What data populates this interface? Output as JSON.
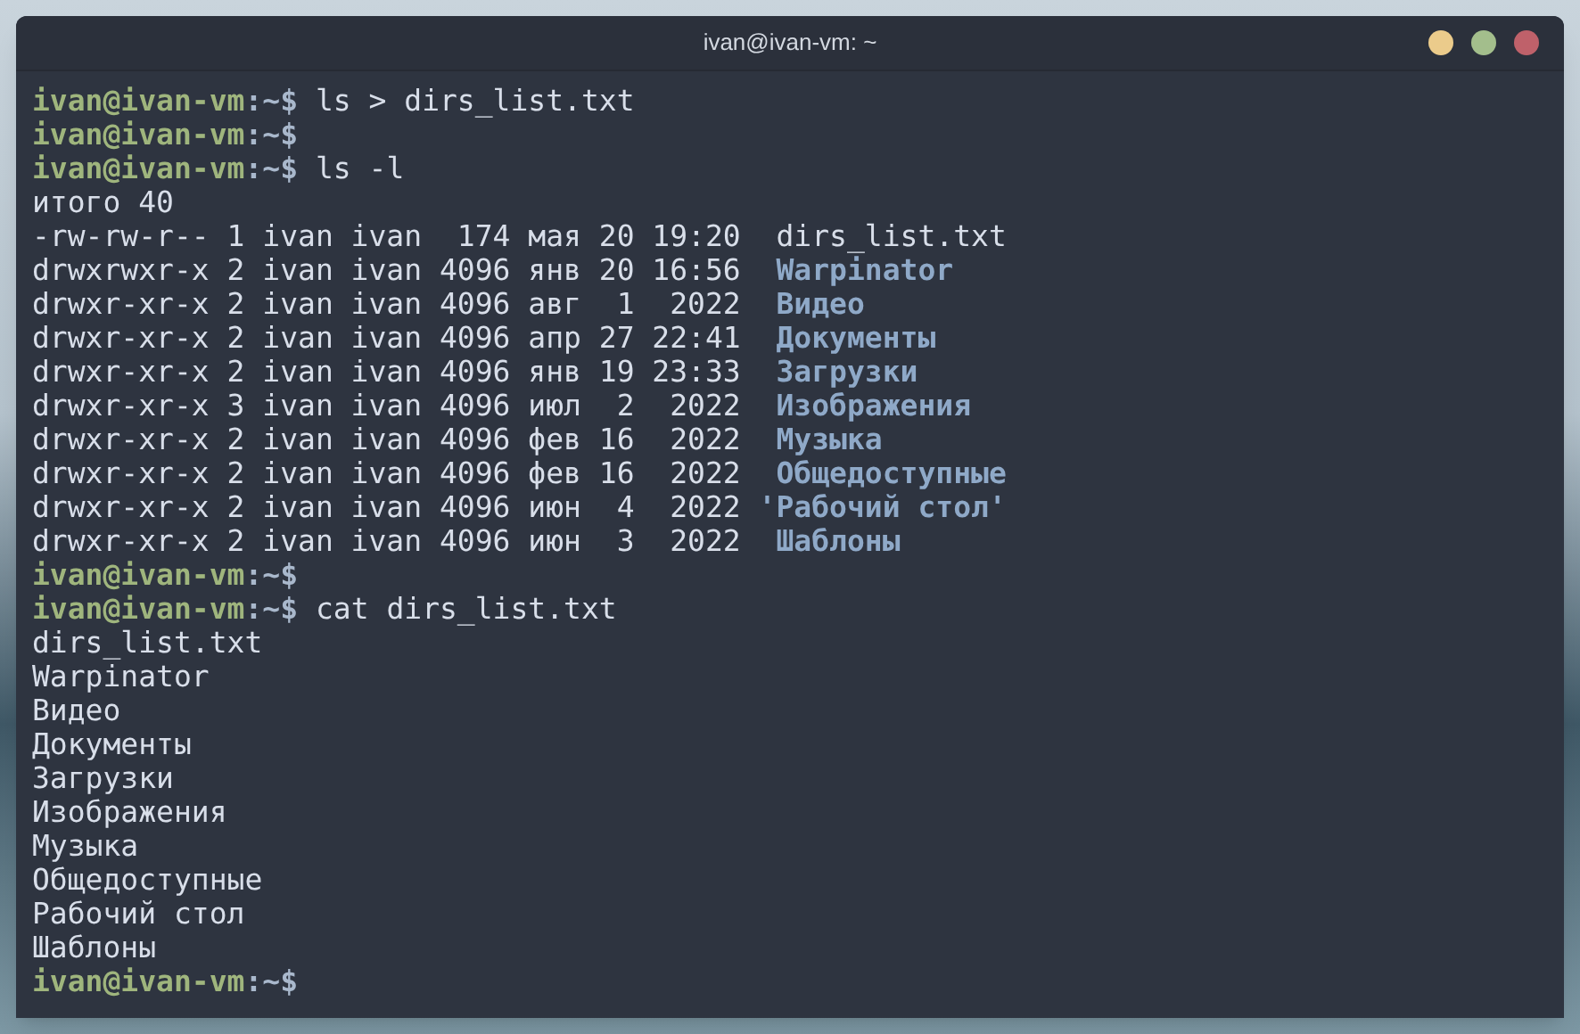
{
  "window": {
    "title": "ivan@ivan-vm: ~"
  },
  "lines": [
    {
      "kind": "prompt",
      "user_host": "ivan@ivan-vm",
      "path": ":~$",
      "command": "ls > dirs_list.txt"
    },
    {
      "kind": "prompt",
      "user_host": "ivan@ivan-vm",
      "path": ":~$"
    },
    {
      "kind": "prompt",
      "user_host": "ivan@ivan-vm",
      "path": ":~$",
      "command": "ls -l"
    },
    {
      "kind": "output",
      "text": "итого 40"
    },
    {
      "kind": "entry",
      "meta": "-rw-rw-r-- 1 ivan ivan  174 мая 20 19:20  ",
      "name": "dirs_list.txt",
      "is_dir": false
    },
    {
      "kind": "entry",
      "meta": "drwxrwxr-x 2 ivan ivan 4096 янв 20 16:56  ",
      "name": "Warpinator",
      "is_dir": true
    },
    {
      "kind": "entry",
      "meta": "drwxr-xr-x 2 ivan ivan 4096 авг  1  2022  ",
      "name": "Видео",
      "is_dir": true
    },
    {
      "kind": "entry",
      "meta": "drwxr-xr-x 2 ivan ivan 4096 апр 27 22:41  ",
      "name": "Документы",
      "is_dir": true
    },
    {
      "kind": "entry",
      "meta": "drwxr-xr-x 2 ivan ivan 4096 янв 19 23:33  ",
      "name": "Загрузки",
      "is_dir": true
    },
    {
      "kind": "entry",
      "meta": "drwxr-xr-x 3 ivan ivan 4096 июл  2  2022  ",
      "name": "Изображения",
      "is_dir": true
    },
    {
      "kind": "entry",
      "meta": "drwxr-xr-x 2 ivan ivan 4096 фев 16  2022  ",
      "name": "Музыка",
      "is_dir": true
    },
    {
      "kind": "entry",
      "meta": "drwxr-xr-x 2 ivan ivan 4096 фев 16  2022  ",
      "name": "Общедоступные",
      "is_dir": true
    },
    {
      "kind": "entry",
      "meta": "drwxr-xr-x 2 ivan ivan 4096 июн  4  2022 ",
      "name": "'Рабочий стол'",
      "is_dir": true
    },
    {
      "kind": "entry",
      "meta": "drwxr-xr-x 2 ivan ivan 4096 июн  3  2022  ",
      "name": "Шаблоны",
      "is_dir": true
    },
    {
      "kind": "prompt",
      "user_host": "ivan@ivan-vm",
      "path": ":~$"
    },
    {
      "kind": "prompt",
      "user_host": "ivan@ivan-vm",
      "path": ":~$",
      "command": "cat dirs_list.txt"
    },
    {
      "kind": "output",
      "text": "dirs_list.txt"
    },
    {
      "kind": "output",
      "text": "Warpinator"
    },
    {
      "kind": "output",
      "text": "Видео"
    },
    {
      "kind": "output",
      "text": "Документы"
    },
    {
      "kind": "output",
      "text": "Загрузки"
    },
    {
      "kind": "output",
      "text": "Изображения"
    },
    {
      "kind": "output",
      "text": "Музыка"
    },
    {
      "kind": "output",
      "text": "Общедоступные"
    },
    {
      "kind": "output",
      "text": "Рабочий стол"
    },
    {
      "kind": "output",
      "text": "Шаблоны"
    },
    {
      "kind": "prompt",
      "user_host": "ivan@ivan-vm",
      "path": ":~$"
    }
  ]
}
